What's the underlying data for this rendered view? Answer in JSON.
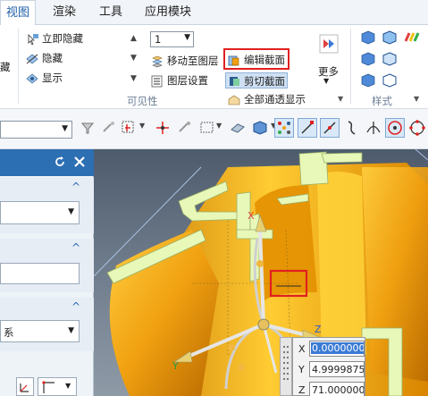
{
  "tabs": [
    {
      "label": "视图",
      "active": true
    },
    {
      "label": "渲染",
      "active": false
    },
    {
      "label": "工具",
      "active": false
    },
    {
      "label": "应用模块",
      "active": false
    }
  ],
  "ribbon": {
    "left_fragment": "藏",
    "hide_items": [
      "立即隐藏",
      "隐藏",
      "显示"
    ],
    "layer_value": "1",
    "move_to_layer": "移动至图层",
    "layer_settings": "图层设置",
    "edit_section": "编辑截面",
    "clip_section": "剪切截面",
    "all_transparent": "全部通透显示",
    "more": "更多",
    "group_visibility": "可见性",
    "group_style": "样式"
  },
  "coords": [
    {
      "axis": "X",
      "value": "0.0000000"
    },
    {
      "axis": "Y",
      "value": "4.9999875"
    },
    {
      "axis": "Z",
      "value": "71.000000"
    }
  ],
  "panel": {
    "mode_fragment": "系"
  },
  "axes": {
    "x": "X",
    "y": "Y",
    "z": "Z"
  },
  "colors": {
    "accent": "#1e5fa8",
    "highlight_box": "#e02020",
    "section_face": "#e8f8b8",
    "body_orange": "#f0a010",
    "panel_header": "#2d6fb3"
  }
}
